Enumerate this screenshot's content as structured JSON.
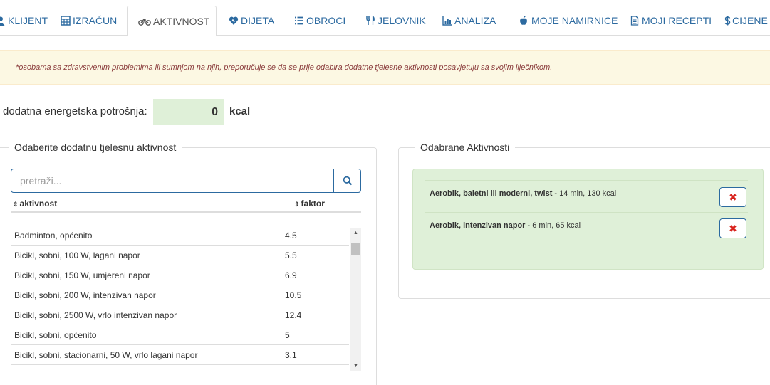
{
  "tabs": [
    {
      "label": "KLIJENT",
      "icon": "user-icon",
      "active": false
    },
    {
      "label": "IZRAČUN",
      "icon": "calculator-icon",
      "active": false
    },
    {
      "label": "AKTIVNOST",
      "icon": "bicycle-icon",
      "active": true
    },
    {
      "label": "DIJETA",
      "icon": "heartbeat-icon",
      "active": false
    },
    {
      "label": "OBROCI",
      "icon": "list-icon",
      "active": false
    },
    {
      "label": "JELOVNIK",
      "icon": "cutlery-icon",
      "active": false
    },
    {
      "label": "ANALIZA",
      "icon": "bar-chart-icon",
      "active": false
    },
    {
      "label": "MOJE NAMIRNICE",
      "icon": "apple-icon",
      "active": false
    },
    {
      "label": "MOJI RECEPTI",
      "icon": "document-icon",
      "active": false
    },
    {
      "label": "CIJENE",
      "icon": "dollar-icon",
      "active": false
    }
  ],
  "alert": {
    "text": "*osobama sa zdravstvenim problemima ili sumnjom na njih, preporučuje se da se prije odabira dodatne tjelesne aktivnosti posavjetuju sa svojim liječnikom."
  },
  "energy": {
    "label": "dodatna energetska potrošnja:",
    "value": "0",
    "unit": "kcal"
  },
  "left_panel": {
    "legend": "Odaberite dodatnu tjelesnu aktivnost",
    "search_placeholder": "pretraži...",
    "search_value": "",
    "columns": [
      "aktivnost",
      "faktor"
    ],
    "rows": [
      {
        "activity": "Badminton, općenito",
        "factor": "4.5"
      },
      {
        "activity": "Bicikl, sobni, 100 W, lagani napor",
        "factor": "5.5"
      },
      {
        "activity": "Bicikl, sobni, 150 W, umjereni napor",
        "factor": "6.9"
      },
      {
        "activity": "Bicikl, sobni, 200 W, intenzivan napor",
        "factor": "10.5"
      },
      {
        "activity": "Bicikl, sobni, 2500 W, vrlo intenzivan napor",
        "factor": "12.4"
      },
      {
        "activity": "Bicikl, sobni, općenito",
        "factor": "5"
      },
      {
        "activity": "Bicikl, sobni, stacionarni, 50 W, vrlo lagani napor",
        "factor": "3.1"
      }
    ]
  },
  "right_panel": {
    "legend": "Odabrane Aktivnosti",
    "items": [
      {
        "name": "Aerobik, baletni ili moderni, twist",
        "details": " - 14 min, 130 kcal"
      },
      {
        "name": "Aerobik, intenzivan napor",
        "details": " - 6 min, 65 kcal"
      }
    ]
  },
  "colors": {
    "link": "#2c6aa0",
    "alert_bg": "#fcf8e3",
    "alert_text": "#8a3b3b",
    "success_bg": "#dff0d8",
    "delete": "#d9231d"
  }
}
